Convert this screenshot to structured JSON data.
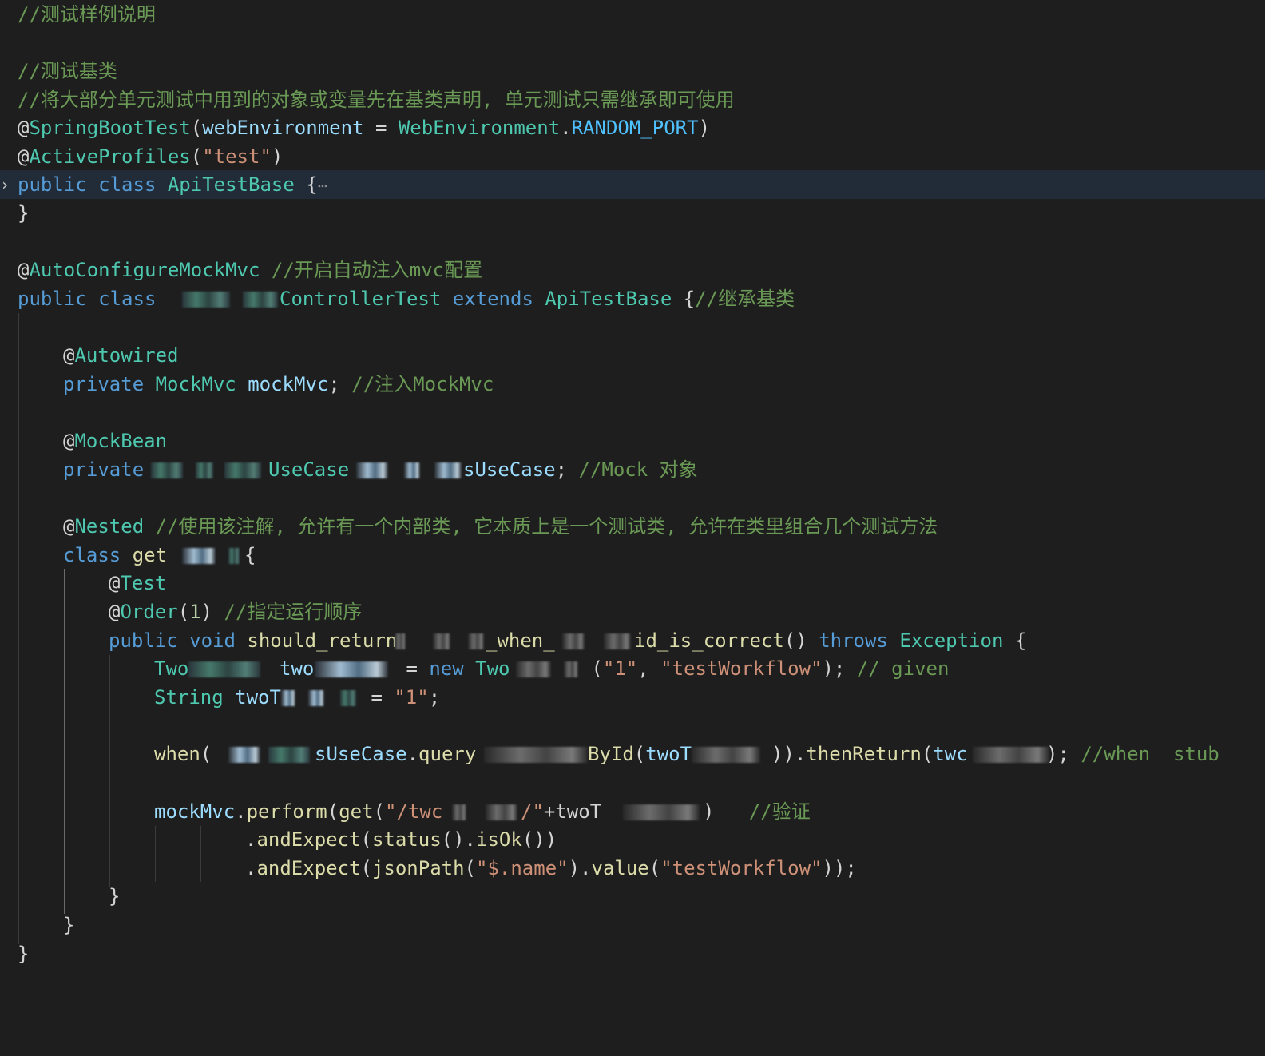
{
  "editor": {
    "fold_marker": "›",
    "ellipsis": "⋯",
    "lines": {
      "l1": "//测试样例说明",
      "l3": "//测试基类",
      "l4": "//将大部分单元测试中用到的对象或变量先在基类声明, 单元测试只需继承即可使用",
      "l5": {
        "at": "@",
        "ann": "SpringBootTest",
        "p1": "(",
        "var": "webEnvironment",
        "eq": " = ",
        "cls": "WebEnvironment",
        "dot": ".",
        "en": "RANDOM_PORT",
        "p2": ")"
      },
      "l6": {
        "at": "@",
        "ann": "ActiveProfiles",
        "p1": "(",
        "str": "\"test\"",
        "p2": ")"
      },
      "l7": {
        "kw": "public class ",
        "cls": "ApiTestBase",
        "brace": " {"
      },
      "l8": "}",
      "l10": {
        "at": "@",
        "ann": "AutoConfigureMockMvc",
        "cm": " //开启自动注入mvc配置"
      },
      "l11": {
        "kw": "public class ",
        "cls": "ControllerTest",
        "ext": " extends ",
        "base": "ApiTestBase",
        "brace": " {",
        "cm": "//继承基类"
      },
      "l13": {
        "at": "@",
        "ann": "Autowired"
      },
      "l14": {
        "kw": "private ",
        "cls": "MockMvc",
        "var": " mockMvc",
        "semi": "; ",
        "cm": "//注入MockMvc"
      },
      "l16": {
        "at": "@",
        "ann": "MockBean"
      },
      "l17": {
        "kw": "private ",
        "cls": "UseCase",
        "var": "sUseCase",
        "semi": "; ",
        "cm": "//Mock 对象"
      },
      "l19": {
        "at": "@",
        "ann": "Nested",
        "cm": " //使用该注解, 允许有一个内部类, 它本质上是一个测试类, 允许在类里组合几个测试方法"
      },
      "l20": {
        "kw": "class ",
        "fn": "get",
        "brace": "{"
      },
      "l21": {
        "at": "@",
        "ann": "Test"
      },
      "l22": {
        "at": "@",
        "ann": "Order",
        "p1": "(",
        "num": "1",
        "p2": ")",
        "cm": " //指定运行顺序"
      },
      "l23": {
        "kw": "public void ",
        "fn1": "should_return",
        "fn2": "_when_",
        "fn3": "id_is_correct",
        "paren": "() ",
        "throws": "throws ",
        "exc": "Exception",
        "brace": " {"
      },
      "l24": {
        "cls": "Two",
        "var": "two",
        "eq": " = ",
        "kw": "new ",
        "cls2": "Two",
        "p1": " (",
        "s1": "\"1\"",
        "comma": ", ",
        "s2": "\"testWorkflow\"",
        "p2": "); ",
        "cm": "// given"
      },
      "l25": {
        "cls": "String ",
        "var": "twoT",
        "eq": " = ",
        "str": "\"1\"",
        "semi": ";"
      },
      "l27": {
        "fn": "when",
        "p1": "(",
        "var": "sUseCase",
        "dot": ".",
        "fn2": "query",
        "fn3": "ById",
        "p2": "(",
        "var2": "twoT",
        "p3": ")).",
        "fn4": "thenReturn",
        "p4": "(",
        "var3": "twc",
        "p5": "); ",
        "cm": "//when  stub"
      },
      "l29": {
        "var": "mockMvc",
        "dot": ".",
        "fn": "perform",
        "p1": "(",
        "fn2": "get",
        "p2": "(",
        "str": "\"/twc",
        "str2": "/\"",
        "plus": "+",
        "var2": "twoT",
        "p3": ")",
        "cm": "   //验证"
      },
      "l30": {
        "dot": ".",
        "fn": "andExpect",
        "p1": "(",
        "fn2": "status",
        "p2": "().",
        "fn3": "isOk",
        "p3": "())"
      },
      "l31": {
        "dot": ".",
        "fn": "andExpect",
        "p1": "(",
        "fn2": "jsonPath",
        "p2": "(",
        "s1": "\"$.name\"",
        "p3": ").",
        "fn3": "value",
        "p4": "(",
        "s2": "\"testWorkflow\"",
        "p5": "));"
      },
      "l32": "}",
      "l33": "}",
      "l34": "}"
    }
  }
}
